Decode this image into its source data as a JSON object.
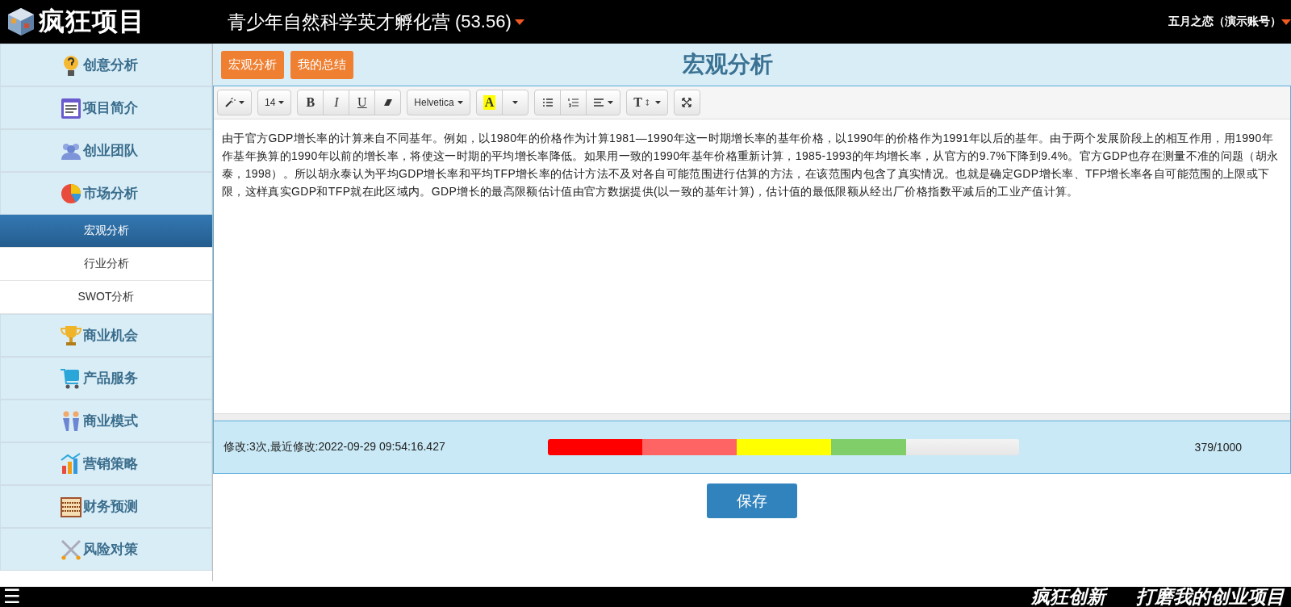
{
  "header": {
    "logo_text": "疯狂项目",
    "title": "青少年自然科学英才孵化营",
    "score": "(53.56)",
    "user": "五月之恋（演示账号）"
  },
  "sidebar": {
    "items": [
      {
        "label": "创意分析"
      },
      {
        "label": "项目简介"
      },
      {
        "label": "创业团队"
      },
      {
        "label": "市场分析",
        "children": [
          {
            "label": "宏观分析",
            "selected": true
          },
          {
            "label": "行业分析",
            "selected": false
          },
          {
            "label": "SWOT分析",
            "selected": false
          }
        ]
      },
      {
        "label": "商业机会"
      },
      {
        "label": "产品服务"
      },
      {
        "label": "商业模式"
      },
      {
        "label": "营销策略"
      },
      {
        "label": "财务预测"
      },
      {
        "label": "风险对策"
      }
    ]
  },
  "top_buttons": [
    "宏观分析",
    "我的总结"
  ],
  "heading": "宏观分析",
  "toolbar": [
    [
      {
        "kind": "magic"
      }
    ],
    [
      {
        "kind": "size",
        "label": "14"
      }
    ],
    [
      {
        "kind": "bold",
        "label": "B"
      },
      {
        "kind": "italic",
        "label": "I"
      },
      {
        "kind": "underline",
        "label": "U"
      },
      {
        "kind": "eraser"
      }
    ],
    [
      {
        "kind": "font",
        "label": "Helvetica"
      }
    ],
    [
      {
        "kind": "highlight",
        "label": "A"
      },
      {
        "kind": "dropdown"
      }
    ],
    [
      {
        "kind": "ul"
      },
      {
        "kind": "ol"
      },
      {
        "kind": "align"
      }
    ],
    [
      {
        "kind": "lineheight",
        "label": "T"
      }
    ],
    [
      {
        "kind": "fullscreen"
      }
    ]
  ],
  "content": "由于官方GDP增长率的计算来自不同基年。例如，以1980年的价格作为计算1981—1990年这一时期增长率的基年价格，以1990年的价格作为1991年以后的基年。由于两个发展阶段上的相互作用，用1990年作基年换算的1990年以前的增长率，将使这一时期的平均增长率降低。如果用一致的1990年基年价格重新计算，1985-1993的年均增长率，从官方的9.7%下降到9.4%。官方GDP也存在测量不准的问题（胡永泰，1998）。所以胡永泰认为平均GDP增长率和平均TFP增长率的估计方法不及对各自可能范围进行估算的方法，在该范围内包含了真实情况。也就是确定GDP增长率、TFP增长率各自可能范围的上限或下限，这样真实GDP和TFP就在此区域内。GDP增长的最高限额估计值由官方数据提供(以一致的基年计算)，估计值的最低限额从经出厂价格指数平减后的工业产值计算。",
  "status": {
    "modified": "修改:3次,最近修改:2022-09-29 09:54:16.427",
    "progress": {
      "level": 0.76
    },
    "count": "379/1000"
  },
  "save_button": "保存",
  "footer": {
    "menu": "☰",
    "slogans": [
      "疯狂创新",
      "打磨我的创业项目"
    ]
  }
}
